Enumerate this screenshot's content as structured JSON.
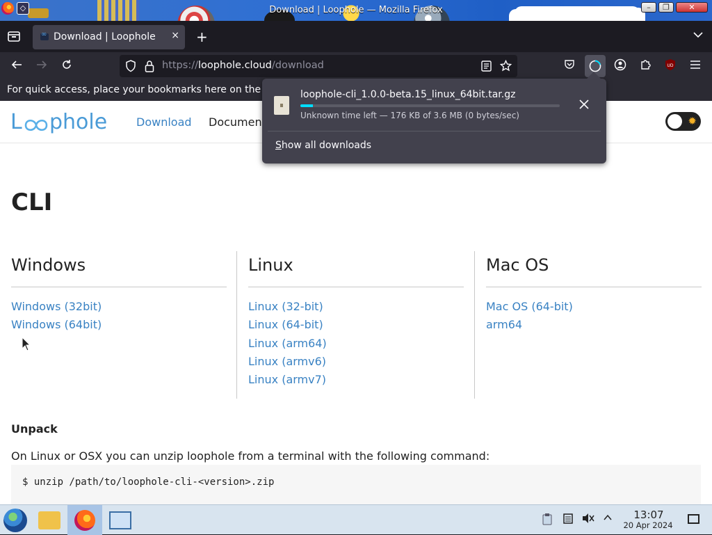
{
  "window": {
    "title": "Download | Loophole — Mozilla Firefox"
  },
  "tabs": [
    {
      "label": "Download | Loophole",
      "close": "×"
    }
  ],
  "tabbar": {
    "new_tab": "+"
  },
  "nav": {
    "url_prefix": "https://",
    "url_domain": "loophole.cloud",
    "url_path": "/download"
  },
  "bookmarks": {
    "message": "For quick access, place your bookmarks here on the bo"
  },
  "site": {
    "logo": "Loophole",
    "nav_download": "Download",
    "nav_docs": "Documen"
  },
  "main": {
    "heading": "CLI",
    "columns": [
      {
        "title": "Windows",
        "links": [
          "Windows (32bit)",
          "Windows (64bit)"
        ]
      },
      {
        "title": "Linux",
        "links": [
          "Linux (32-bit)",
          "Linux (64-bit)",
          "Linux (arm64)",
          "Linux (armv6)",
          "Linux (armv7)"
        ]
      },
      {
        "title": "Mac OS",
        "links": [
          "Mac OS (64-bit)",
          "arm64"
        ]
      }
    ],
    "unpack_heading": "Unpack",
    "unpack_text": "On Linux or OSX you can unzip loophole from a terminal with the following command:",
    "code": "$ unzip /path/to/loophole-cli-<version>.zip"
  },
  "downloads": {
    "filename": "loophole-cli_1.0.0-beta.15_linux_64bit.tar.gz",
    "status": "Unknown time left — 176 KB of 3.6 MB (0 bytes/sec)",
    "progress_percent": 4.8,
    "show_all_first": "S",
    "show_all_rest": "how all downloads"
  },
  "taskbar": {
    "time": "13:07",
    "date": "20 Apr 2024"
  },
  "colors": {
    "accent": "#00ddff",
    "link": "#3982c3",
    "toolbar": "#2b2a33"
  }
}
